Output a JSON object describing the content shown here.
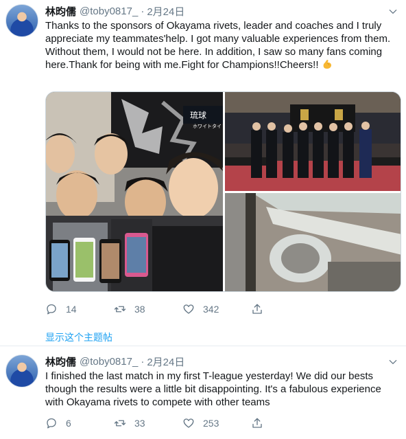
{
  "tweets": [
    {
      "name": "林昀儒",
      "handle": "@toby0817_",
      "dot": "·",
      "time": "2月24日",
      "text": "Thanks to the sponsors of Okayama rivets, leader and coaches and I truly appreciate my teammates'help. I got many valuable experiences from them. Without them, I would not be here. In addition, I saw so many fans coming here.Thank for being with me.Fight for Champions!!Cheers!!",
      "replies": "14",
      "retweets": "38",
      "likes": "342",
      "show_thread": "显示这个主题帖",
      "photo_logo_text": "ホワイトタイ"
    },
    {
      "name": "林昀儒",
      "handle": "@toby0817_",
      "dot": "·",
      "time": "2月24日",
      "text": "I finished the last match in my first T-league yesterday! We did our bests though the results were a little bit disappointing. It's a fabulous experience with Okayama rivets to compete with other teams",
      "replies": "6",
      "retweets": "33",
      "likes": "253"
    }
  ],
  "icons": {
    "more": "chevron-down-icon",
    "reply": "reply-icon",
    "retweet": "retweet-icon",
    "like": "heart-icon",
    "share": "share-icon",
    "emoji": "flexed-biceps-emoji"
  },
  "colors": {
    "link": "#1da1f2",
    "secondary_text": "#657786",
    "divider": "#e6ecf0"
  }
}
